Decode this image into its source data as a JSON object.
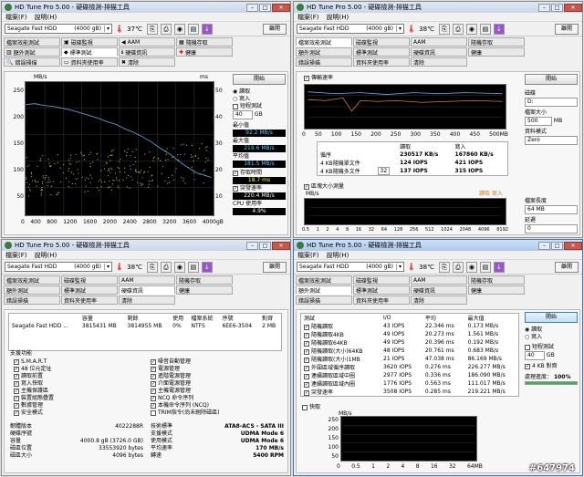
{
  "app": {
    "title": "HD Tune Pro  5.00 - 硬碟檢測-排猫工具",
    "menu": [
      "檔案(F)",
      "說明(H)"
    ],
    "exit": "離開",
    "drive": "Seagate Fast HDD",
    "capacity": "(4000 gB)",
    "temp": "37℃",
    "temp2": "38℃"
  },
  "tabs": [
    "檔案效能測試",
    "磁碟監視",
    "AAM",
    "隨機存取",
    "額外測試",
    "標準測試",
    "硬碟資訊",
    "健康",
    "錯誤掃描",
    "資料夾使用率",
    "清除"
  ],
  "w1": {
    "start": "開始",
    "mode_read": "讀取",
    "mode_write": "寫入",
    "short": "短程測試",
    "short_val": "40",
    "unit_gb": "GB",
    "transfer_min_label": "最小值",
    "transfer_min": "92.2 MB/s",
    "max_label": "最大值",
    "max": "219.6 MB/s",
    "avg_label": "平均值",
    "avg": "181.5 MB/s",
    "access_label": "存取時間",
    "access": "18.7 ms",
    "burst_label": "突發速率",
    "burst": "220.4 MB/s",
    "cpu_label": "CPU 使用率",
    "cpu": "4.9%",
    "y_unit": "MB/s",
    "y2_unit": "ms",
    "y_ticks": [
      "250",
      "200",
      "150",
      "100",
      "50"
    ],
    "y2_ticks": [
      "50",
      "40",
      "30",
      "20",
      "10"
    ],
    "x_ticks": [
      "0",
      "400",
      "800",
      "1200",
      "1600",
      "2000",
      "2400",
      "2800",
      "3200",
      "3600",
      "4000gB"
    ]
  },
  "w2": {
    "transfer_cb": "傳輸速率",
    "x_ticks": [
      "0",
      "50",
      "100",
      "150",
      "200",
      "250",
      "300",
      "350",
      "400",
      "450",
      "500MB"
    ],
    "cols": [
      "讀取",
      "寫入"
    ],
    "rows": [
      {
        "k": "循序",
        "r": "230517 KB/s",
        "w": "167860 KB/s"
      },
      {
        "k": "4 KB隨機單文件",
        "r": "124 IOPS",
        "w": "421 IOPS"
      },
      {
        "k": "4 KB隨機多文件",
        "qd": "32",
        "r": "137 IOPS",
        "w": "315 IOPS"
      }
    ],
    "blocksize_cb": "區塊大小測量",
    "legend": "讀取 寫入",
    "y_unit": "MB/s",
    "bs_ticks": [
      "0.5",
      "1",
      "2",
      "4",
      "8",
      "16",
      "32",
      "64",
      "128",
      "256",
      "512",
      "1024",
      "2048",
      "4096",
      "8192"
    ],
    "start": "開始",
    "drive_label": "磁碟",
    "drive_val": "D:",
    "size_label": "檔案大小",
    "size_val": "500",
    "size_unit": "MB",
    "pattern_label": "資料模式",
    "pattern_val": "Zero",
    "file_len_label": "檔案長度",
    "file_len": "64 MB",
    "delay_label": "延遲",
    "delay": "0"
  },
  "w3": {
    "cols": [
      "容量",
      "剩餘",
      "使用",
      "檔案系統",
      "序號",
      "對齊"
    ],
    "row": [
      "Seagate Fast HDD ...",
      "3815431 MB",
      "3814955 MB",
      "0%",
      "NTFS",
      "6EE6-3504",
      "2 MB"
    ],
    "feat_title": "支援功能",
    "feat_left": [
      "S.M.A.R.T",
      "48 位元定址",
      "讀取前置",
      "寫入快取",
      "主機保護區",
      "裝置組態疊置",
      "數據管理",
      "安全模式"
    ],
    "feat_right": [
      "噪音自動管理",
      "電源管理",
      "進階電源管理",
      "介面電源管理",
      "主機電源管理",
      "NCQ 命令序列",
      "本機命令序列 (NCQ)",
      "TRIM指令(尚未刪除磁區)"
    ],
    "info_left": [
      {
        "k": "韌體版本",
        "v": "4022288R"
      },
      {
        "k": "硬碟序號",
        "v": ""
      },
      {
        "k": "容量",
        "v": "4000.8 gB (3726.0 GB)"
      },
      {
        "k": "磁區位置",
        "v": "33553920 bytes"
      },
      {
        "k": "磁區大小",
        "v": "4096 bytes"
      }
    ],
    "info_right": [
      {
        "k": "技術標準",
        "v": "ATA8-ACS - SATA III"
      },
      {
        "k": "支援模式",
        "v": "UDMA Mode 6"
      },
      {
        "k": "使用模式",
        "v": "UDMA Mode 6"
      },
      {
        "k": "平均速率",
        "v": "170 MB/s"
      },
      {
        "k": "轉速",
        "v": "5400 RPM"
      }
    ]
  },
  "w4": {
    "cols": [
      "測試",
      "I/O",
      "平均",
      "最大值"
    ],
    "rows": [
      {
        "n": "隨機讀取",
        "io": "43 IOPS",
        "avg": "22.346 ms",
        "max": "0.173 MB/s"
      },
      {
        "n": "隨機讀取4KB",
        "io": "49 IOPS",
        "avg": "20.273 ms",
        "max": "1.561 MB/s"
      },
      {
        "n": "隨機讀取64KB",
        "io": "49 IOPS",
        "avg": "20.396 ms",
        "max": "0.192 MB/s"
      },
      {
        "n": "隨機讀取(大小)64KB",
        "io": "48 IOPS",
        "avg": "20.761 ms",
        "max": "0.683 MB/s"
      },
      {
        "n": "隨機讀取(大小)1MB",
        "io": "21 IOPS",
        "avg": "47.038 ms",
        "max": "86.169 MB/s"
      },
      {
        "n": "外圍區域循序讀取",
        "io": "3620 IOPS",
        "avg": "0.276 ms",
        "max": "226.277 MB/s"
      },
      {
        "n": "連續讀取區域中圈",
        "io": "2977 IOPS",
        "avg": "0.336 ms",
        "max": "186.090 MB/s"
      },
      {
        "n": "連續讀取區域內圈",
        "io": "1776 IOPS",
        "avg": "0.563 ms",
        "max": "111.017 MB/s"
      },
      {
        "n": "突發速率",
        "io": "3508 IOPS",
        "avg": "0.285 ms",
        "max": "219.221 MB/s"
      }
    ],
    "cache_cb": "快取",
    "start": "開始",
    "read": "讀取",
    "write": "寫入",
    "short": "短程測試",
    "short_val": "40",
    "unit_gb": "GB",
    "align_cb": "4 KB 對齊",
    "progress_label": "處理進度：",
    "progress": "100%",
    "y_unit": "MB/s",
    "y_ticks": [
      "250",
      "200",
      "150",
      "100",
      "50"
    ],
    "x_ticks": [
      "0",
      "0.5",
      "1",
      "2",
      "4",
      "8",
      "16",
      "32",
      "64MB"
    ]
  },
  "watermark": "#647974"
}
